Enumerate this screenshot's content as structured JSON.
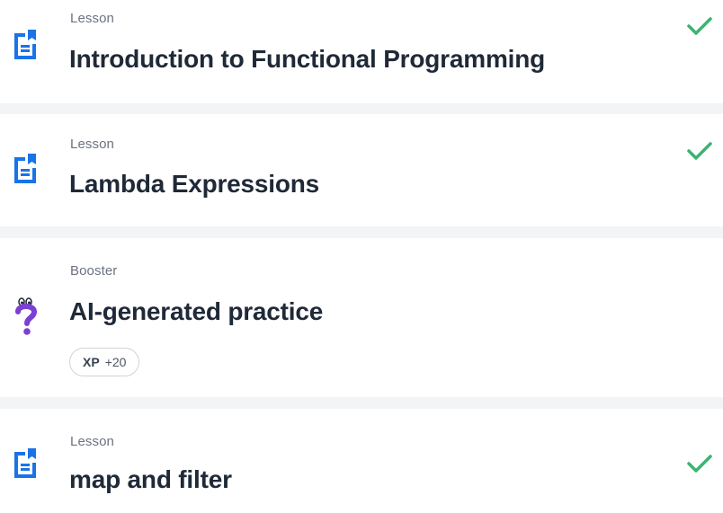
{
  "items": [
    {
      "type": "Lesson",
      "title": "Introduction to Functional Programming",
      "icon": "lesson-document-icon",
      "completed": true
    },
    {
      "type": "Lesson",
      "title": "Lambda Expressions",
      "icon": "lesson-document-icon",
      "completed": true
    },
    {
      "type": "Booster",
      "title": "AI-generated practice",
      "icon": "question-mark-icon",
      "completed": false,
      "xp_label": "XP",
      "xp_value": "+20"
    },
    {
      "type": "Lesson",
      "title": "map and filter",
      "icon": "lesson-document-icon",
      "completed": true
    }
  ],
  "colors": {
    "lesson_icon": "#1a73e8",
    "check": "#3cb371",
    "booster_icon": "#7b3fd4",
    "separator": "#f3f4f6"
  }
}
